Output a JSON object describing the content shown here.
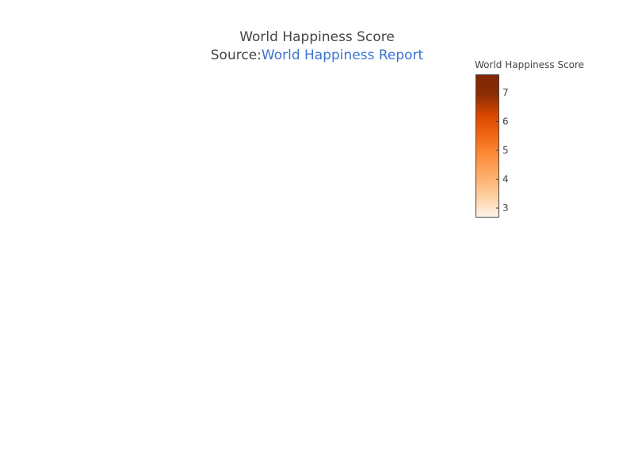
{
  "title": {
    "main": "World Happiness Score",
    "source_prefix": "Source:",
    "source_link": "World Happiness Report"
  },
  "colors": {
    "link": "#3b74d4",
    "text": "#444444",
    "scale": [
      "#fff5eb",
      "#fdd0a2",
      "#fdae6b",
      "#fd8d3c",
      "#f16913",
      "#d94801",
      "#8c2d04",
      "#7f2704"
    ]
  },
  "chart_data": {
    "type": "choropleth",
    "title": "World Happiness Score",
    "colorbar": {
      "title": "World Happiness Score",
      "range": [
        2.7,
        7.6
      ],
      "ticks": [
        3,
        4,
        5,
        6,
        7
      ]
    }
  }
}
